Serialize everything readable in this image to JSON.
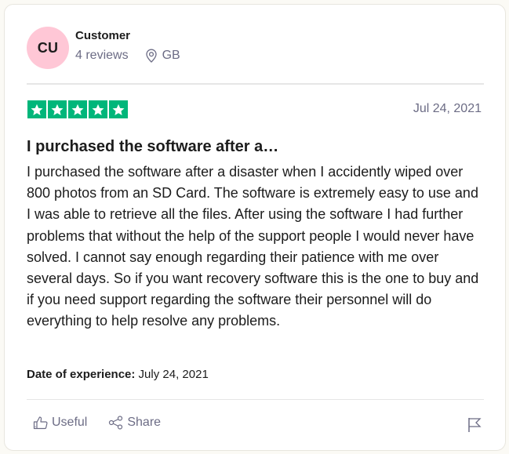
{
  "review": {
    "consumer": {
      "initials": "CU",
      "name": "Customer",
      "reviews_count": "4 reviews",
      "location": "GB",
      "location_icon": "location-pin-icon",
      "avatar_color": "#ffc7d6"
    },
    "rating": {
      "stars": 5,
      "max_stars": 5,
      "star_color": "#00b67a",
      "star_icon": "star-icon"
    },
    "date": "Jul 24, 2021",
    "title": "I purchased the software after a…",
    "body": "I purchased the software after a disaster when I accidently wiped over 800 photos from an SD Card. The software is extremely easy to use and I was able to retrieve all the files. After using the software I had further problems that without the help of the support people I would never have solved. I cannot say enough regarding their patience with me over several days. So if you want recovery software this is the one to buy and if you need support regarding the software their personnel will do everything to help resolve any problems.",
    "experience": {
      "label": "Date of experience:",
      "value": " July 24, 2021"
    },
    "actions": {
      "useful_label": "Useful",
      "useful_icon": "thumbs-up-icon",
      "share_label": "Share",
      "share_icon": "share-icon",
      "report_icon": "flag-icon"
    }
  }
}
